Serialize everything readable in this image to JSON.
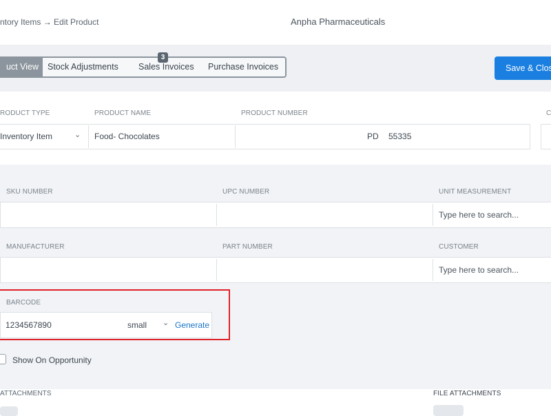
{
  "header": {
    "breadcrumb_parent": "ntory Items",
    "breadcrumb_arrow": "→",
    "breadcrumb_current": "Edit Product",
    "company": "Anpha Pharmaceuticals"
  },
  "tabs": [
    {
      "label": "uct View",
      "active": true
    },
    {
      "label": "Stock Adjustments",
      "active": false
    },
    {
      "label": "Sales Invoices",
      "active": false,
      "badge": "3"
    },
    {
      "label": "Purchase Invoices",
      "active": false
    }
  ],
  "toolbar": {
    "save_label": "Save & Clos"
  },
  "product": {
    "type_label": "RODUCT TYPE",
    "type_value": "Inventory Item",
    "name_label": "PRODUCT NAME",
    "name_value": "Food- Chocolates",
    "number_label": "PRODUCT NUMBER",
    "number_prefix": "PD",
    "number_value": "55335",
    "partial_label": "C"
  },
  "details": {
    "sku_label": "SKU NUMBER",
    "upc_label": "UPC NUMBER",
    "unit_label": "UNIT MEASUREMENT",
    "unit_placeholder": "Type here to search...",
    "manufacturer_label": "MANUFACTURER",
    "part_label": "PART NUMBER",
    "customer_label": "CUSTOMER",
    "customer_placeholder": "Type here to search..."
  },
  "barcode": {
    "label": "BARCODE",
    "value": "1234567890",
    "size": "small",
    "generate_label": "Generate"
  },
  "opportunity": {
    "label": "Show On Opportunity",
    "checked": false
  },
  "attachments": {
    "left_label": "ATTACHMENTS",
    "right_label": "FILE ATTACHMENTS"
  },
  "icons": {
    "dropdown": "chevron-down-icon",
    "breadcrumb_arrow": "arrow-right-icon"
  },
  "colors": {
    "accent": "#1a7fe0",
    "highlight": "#e02027",
    "active_tab": "#8c959d",
    "section_bg": "#f1f3f6"
  }
}
